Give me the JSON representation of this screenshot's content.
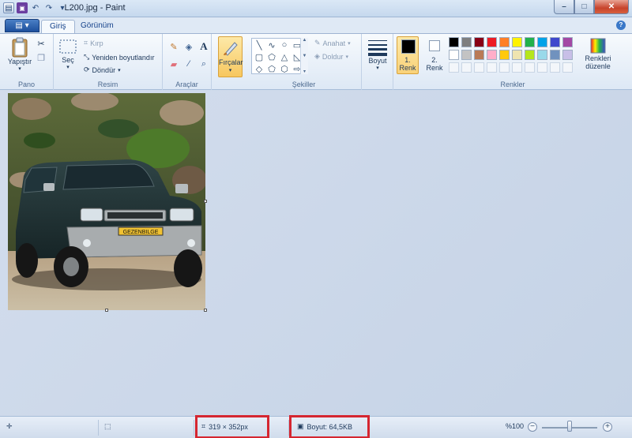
{
  "window": {
    "title": "L200.jpg - Paint"
  },
  "tabs": {
    "home": "Giriş",
    "view": "Görünüm"
  },
  "clipboard": {
    "paste": "Yapıştır",
    "group": "Pano"
  },
  "image": {
    "select": "Seç",
    "crop": "Kırp",
    "resize": "Yeniden boyutlandır",
    "rotate": "Döndür",
    "group": "Resim"
  },
  "tools": {
    "group": "Araçlar"
  },
  "brushes": {
    "label": "Fırçalar"
  },
  "shapes": {
    "outline": "Anahat",
    "fill": "Doldur",
    "group": "Şekiller"
  },
  "size": {
    "label": "Boyut"
  },
  "colors": {
    "color1": "1.",
    "color1_b": "Renk",
    "color2": "2.",
    "color2_b": "Renk",
    "edit": "Renkleri",
    "edit_b": "düzenle",
    "group": "Renkler",
    "color1_value": "#000000",
    "color2_value": "#ffffff",
    "palette_row1": [
      "#000000",
      "#7f7f7f",
      "#880015",
      "#ed1c24",
      "#ff7f27",
      "#fff200",
      "#22b14c",
      "#00a2e8",
      "#3f48cc",
      "#a349a4"
    ],
    "palette_row2": [
      "#ffffff",
      "#c3c3c3",
      "#b97a57",
      "#ffaec9",
      "#ffc90e",
      "#efe4b0",
      "#b5e61d",
      "#99d9ea",
      "#7092be",
      "#c8bfe7"
    ]
  },
  "status": {
    "dimensions": "319 × 352px",
    "filesize": "Boyut: 64,5KB",
    "zoom": "%100"
  },
  "plate": {
    "text": "GEZENBILGE"
  }
}
